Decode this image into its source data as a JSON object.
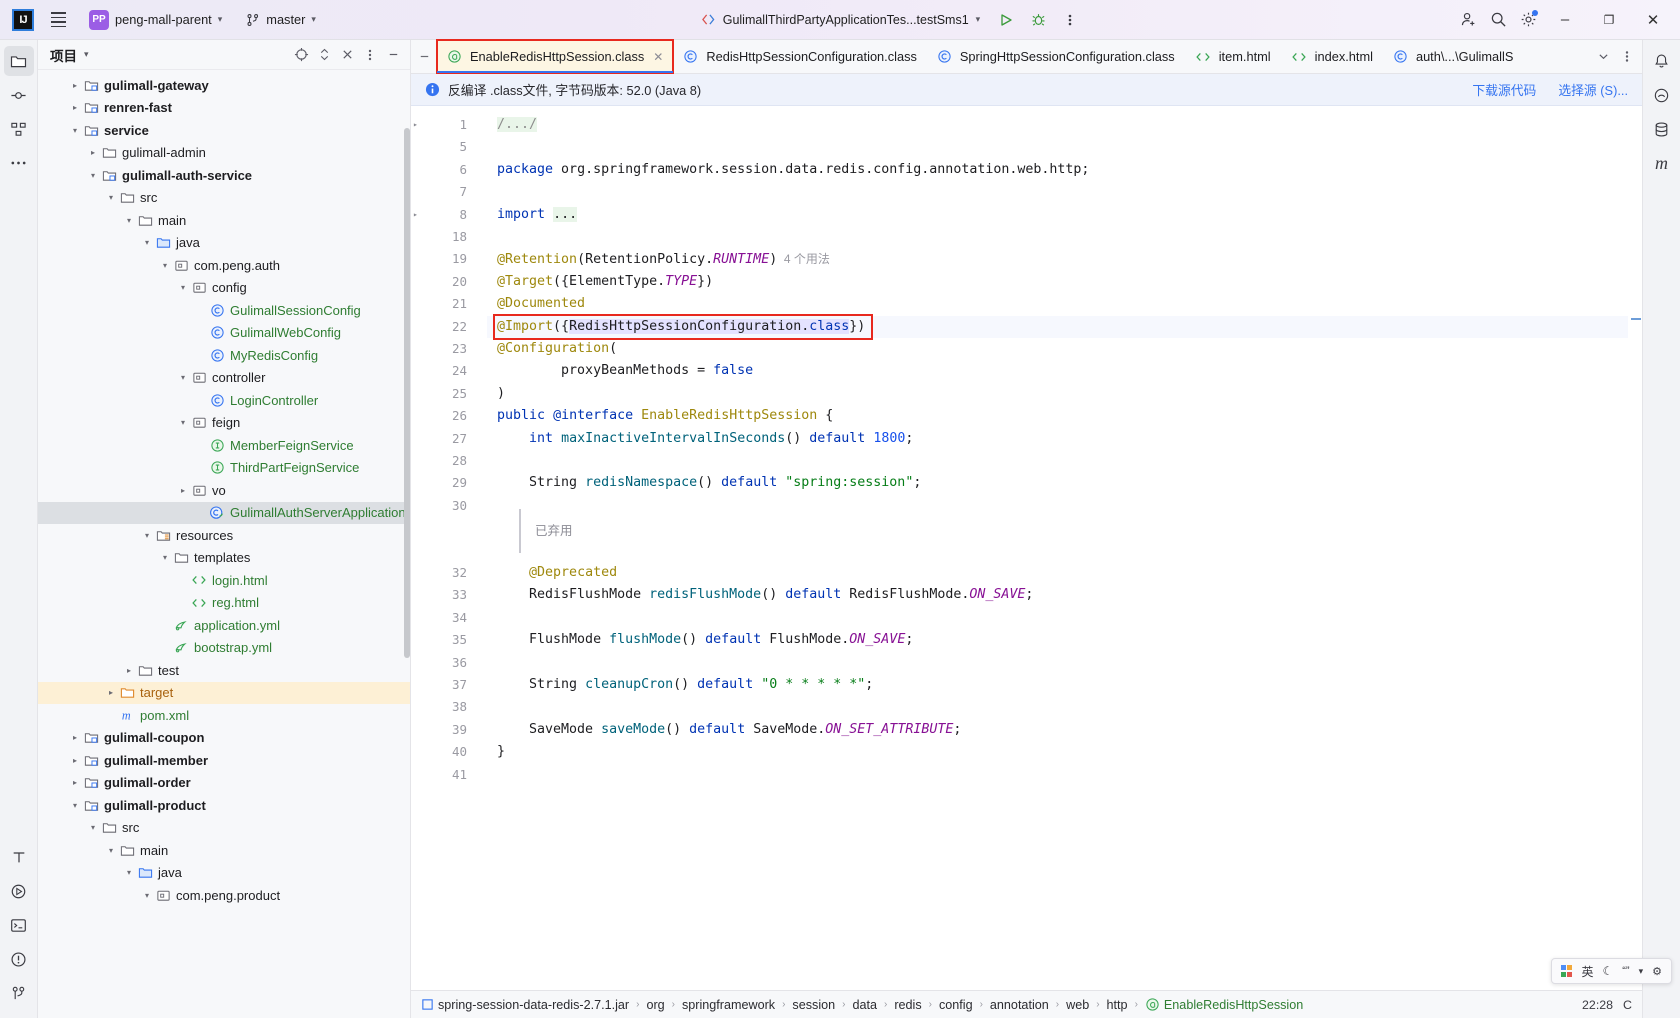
{
  "titlebar": {
    "logo": "IJ",
    "menu_icon": "hamburger-icon",
    "project_badge": "PP",
    "project_name": "peng-mall-parent",
    "branch_icon": "git-branch-icon",
    "branch_name": "master",
    "run_config": "GulimallThirdPartyApplicationTes...testSms1",
    "run_icon": "run-icon",
    "debug_icon": "debug-icon",
    "more_icon": "more-vertical-icon",
    "account_icon": "add-user-icon",
    "search_icon": "search-icon",
    "settings_icon": "gear-icon",
    "minimize": "–",
    "maximize": "❐",
    "close": "✕"
  },
  "left_rail": [
    {
      "name": "project-tool-window",
      "icon": "folder-icon",
      "active": true
    },
    {
      "name": "commit-tool-window",
      "icon": "commit-icon",
      "active": false
    },
    {
      "name": "structure-tool-window",
      "icon": "structure-icon",
      "active": false
    },
    {
      "name": "more-tool-windows",
      "icon": "ellipsis-icon",
      "active": false
    }
  ],
  "left_rail_bottom": [
    {
      "name": "structure-bottom",
      "icon": "font-structure-icon"
    },
    {
      "name": "services-tool-window",
      "icon": "play-circle-icon"
    },
    {
      "name": "terminal-tool-window",
      "icon": "terminal-icon"
    },
    {
      "name": "problems-tool-window",
      "icon": "warning-circle-icon"
    },
    {
      "name": "git-tool-window",
      "icon": "git-icon"
    }
  ],
  "right_rail": [
    {
      "name": "notifications",
      "icon": "bell-icon"
    },
    {
      "name": "ai-assistant",
      "icon": "ai-icon"
    },
    {
      "name": "database-tool-window",
      "icon": "database-icon"
    },
    {
      "name": "maven-tool-window",
      "icon": "maven-m-icon"
    }
  ],
  "project_pane": {
    "title": "项目",
    "title_chevron": "chevron-down-icon",
    "actions": [
      {
        "name": "select-opened-file-button",
        "icon": "target-icon"
      },
      {
        "name": "expand-collapse-button",
        "icon": "expand-collapse-icon"
      },
      {
        "name": "collapse-all-button",
        "icon": "collapse-all-icon"
      },
      {
        "name": "options-button",
        "icon": "more-vertical-icon"
      },
      {
        "name": "hide-button",
        "icon": "minimize-icon"
      }
    ],
    "tree": [
      {
        "depth": 1,
        "arrow": "closed",
        "icon": "module-icon",
        "label": "gulimall-gateway",
        "style": "bold"
      },
      {
        "depth": 1,
        "arrow": "closed",
        "icon": "module-icon",
        "label": "renren-fast",
        "style": "bold"
      },
      {
        "depth": 1,
        "arrow": "open",
        "icon": "module-icon",
        "label": "service",
        "style": "bold"
      },
      {
        "depth": 2,
        "arrow": "closed",
        "icon": "folder-icon",
        "label": "gulimall-admin",
        "style": ""
      },
      {
        "depth": 2,
        "arrow": "open",
        "icon": "module-icon",
        "label": "gulimall-auth-service",
        "style": "bold"
      },
      {
        "depth": 3,
        "arrow": "open",
        "icon": "folder-icon",
        "label": "src",
        "style": ""
      },
      {
        "depth": 4,
        "arrow": "open",
        "icon": "folder-icon",
        "label": "main",
        "style": ""
      },
      {
        "depth": 5,
        "arrow": "open",
        "icon": "source-folder-icon",
        "label": "java",
        "style": ""
      },
      {
        "depth": 6,
        "arrow": "open",
        "icon": "package-icon",
        "label": "com.peng.auth",
        "style": ""
      },
      {
        "depth": 7,
        "arrow": "open",
        "icon": "package-icon",
        "label": "config",
        "style": ""
      },
      {
        "depth": 8,
        "arrow": "none",
        "icon": "class-icon",
        "label": "GulimallSessionConfig",
        "style": "green"
      },
      {
        "depth": 8,
        "arrow": "none",
        "icon": "class-icon",
        "label": "GulimallWebConfig",
        "style": "green"
      },
      {
        "depth": 8,
        "arrow": "none",
        "icon": "class-icon",
        "label": "MyRedisConfig",
        "style": "green"
      },
      {
        "depth": 7,
        "arrow": "open",
        "icon": "package-icon",
        "label": "controller",
        "style": ""
      },
      {
        "depth": 8,
        "arrow": "none",
        "icon": "class-icon",
        "label": "LoginController",
        "style": "green"
      },
      {
        "depth": 7,
        "arrow": "open",
        "icon": "package-icon",
        "label": "feign",
        "style": ""
      },
      {
        "depth": 8,
        "arrow": "none",
        "icon": "interface-icon",
        "label": "MemberFeignService",
        "style": "green"
      },
      {
        "depth": 8,
        "arrow": "none",
        "icon": "interface-icon",
        "label": "ThirdPartFeignService",
        "style": "green"
      },
      {
        "depth": 7,
        "arrow": "closed",
        "icon": "package-icon",
        "label": "vo",
        "style": ""
      },
      {
        "depth": 8,
        "arrow": "none",
        "icon": "spring-class-icon",
        "label": "GulimallAuthServerApplication",
        "style": "green",
        "selected": true
      },
      {
        "depth": 5,
        "arrow": "open",
        "icon": "resources-folder-icon",
        "label": "resources",
        "style": ""
      },
      {
        "depth": 6,
        "arrow": "open",
        "icon": "folder-icon",
        "label": "templates",
        "style": ""
      },
      {
        "depth": 7,
        "arrow": "none",
        "icon": "html-icon",
        "label": "login.html",
        "style": "green"
      },
      {
        "depth": 7,
        "arrow": "none",
        "icon": "html-icon",
        "label": "reg.html",
        "style": "green"
      },
      {
        "depth": 6,
        "arrow": "none",
        "icon": "yml-icon",
        "label": "application.yml",
        "style": "green"
      },
      {
        "depth": 6,
        "arrow": "none",
        "icon": "yml-icon",
        "label": "bootstrap.yml",
        "style": "green"
      },
      {
        "depth": 4,
        "arrow": "closed",
        "icon": "folder-icon",
        "label": "test",
        "style": ""
      },
      {
        "depth": 3,
        "arrow": "closed",
        "icon": "target-folder-icon",
        "label": "target",
        "style": "orange",
        "highlight": true
      },
      {
        "depth": 3,
        "arrow": "none",
        "icon": "maven-m-icon",
        "label": "pom.xml",
        "style": "green"
      },
      {
        "depth": 1,
        "arrow": "closed",
        "icon": "module-icon",
        "label": "gulimall-coupon",
        "style": "bold"
      },
      {
        "depth": 1,
        "arrow": "closed",
        "icon": "module-icon",
        "label": "gulimall-member",
        "style": "bold"
      },
      {
        "depth": 1,
        "arrow": "closed",
        "icon": "module-icon",
        "label": "gulimall-order",
        "style": "bold"
      },
      {
        "depth": 1,
        "arrow": "open",
        "icon": "module-icon",
        "label": "gulimall-product",
        "style": "bold"
      },
      {
        "depth": 2,
        "arrow": "open",
        "icon": "folder-icon",
        "label": "src",
        "style": ""
      },
      {
        "depth": 3,
        "arrow": "open",
        "icon": "folder-icon",
        "label": "main",
        "style": ""
      },
      {
        "depth": 4,
        "arrow": "open",
        "icon": "source-folder-icon",
        "label": "java",
        "style": ""
      },
      {
        "depth": 5,
        "arrow": "open",
        "icon": "package-icon",
        "label": "com.peng.product",
        "style": ""
      }
    ]
  },
  "editor": {
    "collapse_icon": "minimize-icon",
    "tabs": [
      {
        "icon": "annotation-icon",
        "label": "EnableRedisHttpSession.class",
        "active": true,
        "closable": true,
        "marked": true
      },
      {
        "icon": "class-icon",
        "label": "RedisHttpSessionConfiguration.class",
        "active": false,
        "closable": false,
        "marked": false
      },
      {
        "icon": "class-icon",
        "label": "SpringHttpSessionConfiguration.class",
        "active": false,
        "closable": false,
        "marked": false
      },
      {
        "icon": "html-icon",
        "label": "item.html",
        "active": false,
        "closable": false,
        "marked": false
      },
      {
        "icon": "html-icon",
        "label": "index.html",
        "active": false,
        "closable": false,
        "marked": false
      },
      {
        "icon": "class-icon",
        "label": "auth\\...\\GulimallS",
        "active": false,
        "closable": false,
        "marked": false
      }
    ],
    "tabs_overflow_icon": "chevron-down-icon",
    "tabs_options_icon": "more-vertical-icon",
    "notification": {
      "icon": "info-icon",
      "text": "反编译 .class文件, 字节码版本: 52.0 (Java 8)",
      "links": [
        "下载源代码",
        "选择源 (S)..."
      ]
    },
    "lines": [
      {
        "num": "1",
        "fold": "closed",
        "tokens": [
          {
            "t": "/.../",
            "c": "foldbox cm"
          }
        ]
      },
      {
        "num": "5",
        "fold": "",
        "tokens": []
      },
      {
        "num": "6",
        "fold": "",
        "tokens": [
          {
            "t": "package",
            "c": "k"
          },
          {
            "t": " org.springframework.session.data.redis.config.annotation.web.http;",
            "c": "t"
          }
        ]
      },
      {
        "num": "7",
        "fold": "",
        "tokens": []
      },
      {
        "num": "8",
        "fold": "closed",
        "tokens": [
          {
            "t": "import",
            "c": "k"
          },
          {
            "t": " ",
            "c": "t"
          },
          {
            "t": "...",
            "c": "foldbox t"
          }
        ]
      },
      {
        "num": "18",
        "fold": "",
        "tokens": []
      },
      {
        "num": "19",
        "fold": "",
        "tokens": [
          {
            "t": "@Retention",
            "c": "ann"
          },
          {
            "t": "(RetentionPolicy.",
            "c": "t"
          },
          {
            "t": "RUNTIME",
            "c": "sf"
          },
          {
            "t": ")",
            "c": "t"
          },
          {
            "t": "  4 个用法",
            "c": "hint"
          }
        ]
      },
      {
        "num": "20",
        "fold": "",
        "tokens": [
          {
            "t": "@Target",
            "c": "ann"
          },
          {
            "t": "({ElementType.",
            "c": "t"
          },
          {
            "t": "TYPE",
            "c": "sf"
          },
          {
            "t": "})",
            "c": "t"
          }
        ]
      },
      {
        "num": "21",
        "fold": "",
        "tokens": [
          {
            "t": "@Documented",
            "c": "ann"
          }
        ]
      },
      {
        "num": "22",
        "fold": "",
        "marked": true,
        "current": true,
        "tokens": [
          {
            "t": "@Import",
            "c": "ann"
          },
          {
            "t": "({",
            "c": "t"
          },
          {
            "t": "RedisHttpSessionConfiguration",
            "c": "t sel-bg"
          },
          {
            "t": ".",
            "c": "t sel-bg"
          },
          {
            "t": "class",
            "c": "k sel-bg"
          },
          {
            "t": "})",
            "c": "t"
          }
        ]
      },
      {
        "num": "23",
        "fold": "",
        "tokens": [
          {
            "t": "@Configuration",
            "c": "ann"
          },
          {
            "t": "(",
            "c": "t"
          }
        ]
      },
      {
        "num": "24",
        "fold": "",
        "tokens": [
          {
            "t": "        proxyBeanMethods = ",
            "c": "t"
          },
          {
            "t": "false",
            "c": "k"
          }
        ]
      },
      {
        "num": "25",
        "fold": "",
        "tokens": [
          {
            "t": ")",
            "c": "t"
          }
        ]
      },
      {
        "num": "26",
        "fold": "",
        "tokens": [
          {
            "t": "public",
            "c": "k"
          },
          {
            "t": " ",
            "c": "t"
          },
          {
            "t": "@interface",
            "c": "k"
          },
          {
            "t": " ",
            "c": "t"
          },
          {
            "t": "EnableRedisHttpSession",
            "c": "ty"
          },
          {
            "t": " {",
            "c": "t"
          }
        ]
      },
      {
        "num": "27",
        "fold": "",
        "tokens": [
          {
            "t": "    ",
            "c": "t"
          },
          {
            "t": "int",
            "c": "k"
          },
          {
            "t": " ",
            "c": "t"
          },
          {
            "t": "maxInactiveIntervalInSeconds",
            "c": "m"
          },
          {
            "t": "() ",
            "c": "t"
          },
          {
            "t": "default",
            "c": "k"
          },
          {
            "t": " ",
            "c": "t"
          },
          {
            "t": "1800",
            "c": "n"
          },
          {
            "t": ";",
            "c": "t"
          }
        ]
      },
      {
        "num": "28",
        "fold": "",
        "tokens": []
      },
      {
        "num": "29",
        "fold": "",
        "tokens": [
          {
            "t": "    String ",
            "c": "t"
          },
          {
            "t": "redisNamespace",
            "c": "m"
          },
          {
            "t": "() ",
            "c": "t"
          },
          {
            "t": "default",
            "c": "k"
          },
          {
            "t": " ",
            "c": "t"
          },
          {
            "t": "\"spring:session\"",
            "c": "s"
          },
          {
            "t": ";",
            "c": "t"
          }
        ]
      },
      {
        "num": "30",
        "fold": "",
        "tokens": []
      },
      {
        "num": "",
        "fold": "",
        "deprecated_note": "已弃用"
      },
      {
        "num": "",
        "fold": "",
        "tokens": []
      },
      {
        "num": "32",
        "fold": "",
        "tokens": [
          {
            "t": "    ",
            "c": "t"
          },
          {
            "t": "@Deprecated",
            "c": "ann"
          }
        ]
      },
      {
        "num": "33",
        "fold": "",
        "tokens": [
          {
            "t": "    RedisFlushMode ",
            "c": "t"
          },
          {
            "t": "redisFlushMode",
            "c": "m"
          },
          {
            "t": "() ",
            "c": "t"
          },
          {
            "t": "default",
            "c": "k"
          },
          {
            "t": " RedisFlushMode.",
            "c": "t"
          },
          {
            "t": "ON_SAVE",
            "c": "sf"
          },
          {
            "t": ";",
            "c": "t"
          }
        ]
      },
      {
        "num": "34",
        "fold": "",
        "tokens": []
      },
      {
        "num": "35",
        "fold": "",
        "tokens": [
          {
            "t": "    FlushMode ",
            "c": "t"
          },
          {
            "t": "flushMode",
            "c": "m"
          },
          {
            "t": "() ",
            "c": "t"
          },
          {
            "t": "default",
            "c": "k"
          },
          {
            "t": " FlushMode.",
            "c": "t"
          },
          {
            "t": "ON_SAVE",
            "c": "sf"
          },
          {
            "t": ";",
            "c": "t"
          }
        ]
      },
      {
        "num": "36",
        "fold": "",
        "tokens": []
      },
      {
        "num": "37",
        "fold": "",
        "tokens": [
          {
            "t": "    String ",
            "c": "t"
          },
          {
            "t": "cleanupCron",
            "c": "m"
          },
          {
            "t": "() ",
            "c": "t"
          },
          {
            "t": "default",
            "c": "k"
          },
          {
            "t": " ",
            "c": "t"
          },
          {
            "t": "\"0 * * * * *\"",
            "c": "s"
          },
          {
            "t": ";",
            "c": "t"
          }
        ]
      },
      {
        "num": "38",
        "fold": "",
        "tokens": []
      },
      {
        "num": "39",
        "fold": "",
        "tokens": [
          {
            "t": "    SaveMode ",
            "c": "t"
          },
          {
            "t": "saveMode",
            "c": "m"
          },
          {
            "t": "() ",
            "c": "t"
          },
          {
            "t": "default",
            "c": "k"
          },
          {
            "t": " SaveMode.",
            "c": "t"
          },
          {
            "t": "ON_SET_ATTRIBUTE",
            "c": "sf"
          },
          {
            "t": ";",
            "c": "t"
          }
        ]
      },
      {
        "num": "40",
        "fold": "",
        "tokens": [
          {
            "t": "}",
            "c": "t"
          }
        ]
      },
      {
        "num": "41",
        "fold": "",
        "tokens": []
      }
    ]
  },
  "statusbar": {
    "breadcrumb": [
      {
        "icon": "jar-icon",
        "label": "spring-session-data-redis-2.7.1.jar"
      },
      {
        "icon": "",
        "label": "org"
      },
      {
        "icon": "",
        "label": "springframework"
      },
      {
        "icon": "",
        "label": "session"
      },
      {
        "icon": "",
        "label": "data"
      },
      {
        "icon": "",
        "label": "redis"
      },
      {
        "icon": "",
        "label": "config"
      },
      {
        "icon": "",
        "label": "annotation"
      },
      {
        "icon": "",
        "label": "web"
      },
      {
        "icon": "",
        "label": "http"
      },
      {
        "icon": "annotation-icon",
        "label": "EnableRedisHttpSession"
      }
    ],
    "time": "22:28",
    "right_text": "C"
  },
  "ime": {
    "keyboard_icon": "keyboard-icon",
    "lang": "英",
    "moon_icon": "moon-icon",
    "punct_icon": "punctuation-icon",
    "more_icon": "chevron-icon",
    "settings_icon": "gear-icon"
  },
  "colors": {
    "accent": "#3574f0",
    "marker_red": "#e8291e",
    "tab_active_bg": "#fdf6e3",
    "highlight_row": "#fdf0d5",
    "green_text": "#2f7d32"
  }
}
